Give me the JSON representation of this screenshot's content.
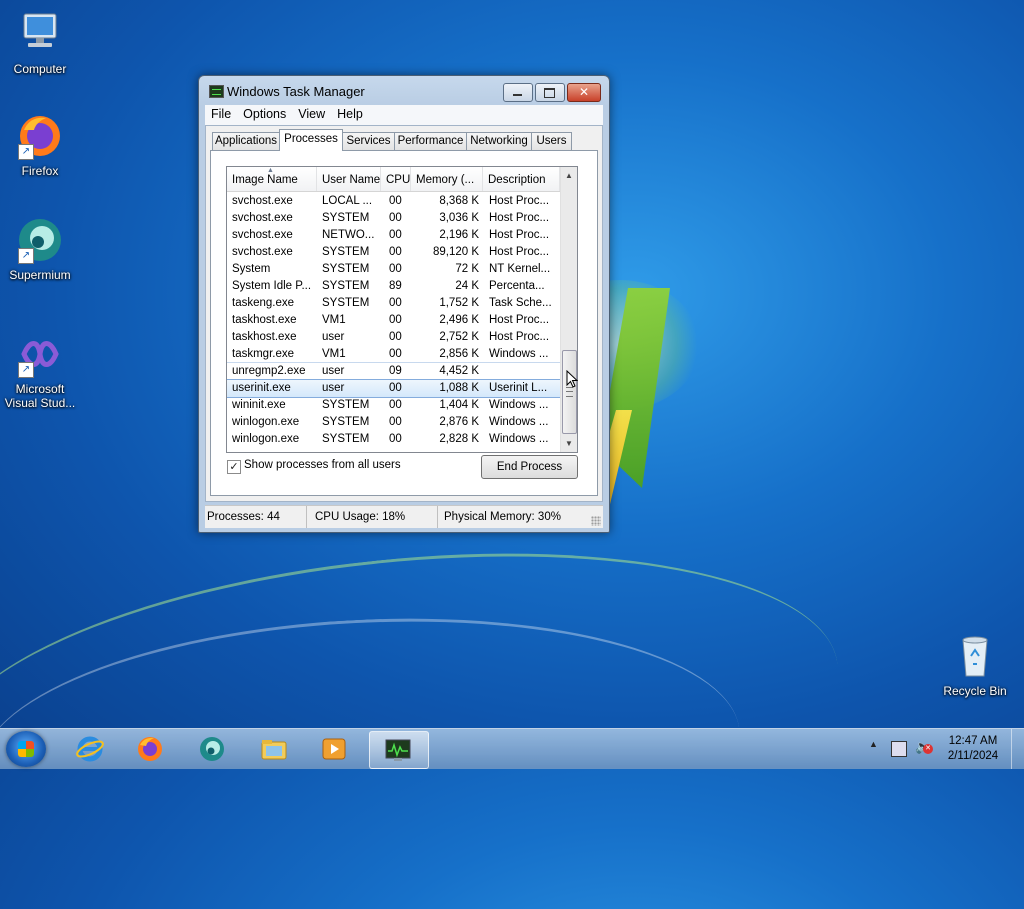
{
  "desktop": {
    "icons": [
      {
        "label": "Computer"
      },
      {
        "label": "Firefox"
      },
      {
        "label": "Supermium"
      },
      {
        "label": "Microsoft Visual Stud..."
      },
      {
        "label": "Recycle Bin"
      }
    ]
  },
  "window": {
    "title": "Windows Task Manager",
    "menu": [
      "File",
      "Options",
      "View",
      "Help"
    ],
    "tabs": [
      "Applications",
      "Processes",
      "Services",
      "Performance",
      "Networking",
      "Users"
    ],
    "active_tab": "Processes",
    "columns": [
      "Image Name",
      "User Name",
      "CPU",
      "Memory (...",
      "Description"
    ],
    "rows": [
      {
        "name": "svchost.exe",
        "user": "LOCAL ...",
        "cpu": "00",
        "mem": "8,368 K",
        "desc": "Host Proc..."
      },
      {
        "name": "svchost.exe",
        "user": "SYSTEM",
        "cpu": "00",
        "mem": "3,036 K",
        "desc": "Host Proc..."
      },
      {
        "name": "svchost.exe",
        "user": "NETWO...",
        "cpu": "00",
        "mem": "2,196 K",
        "desc": "Host Proc..."
      },
      {
        "name": "svchost.exe",
        "user": "SYSTEM",
        "cpu": "00",
        "mem": "89,120 K",
        "desc": "Host Proc..."
      },
      {
        "name": "System",
        "user": "SYSTEM",
        "cpu": "00",
        "mem": "72 K",
        "desc": "NT Kernel..."
      },
      {
        "name": "System Idle P...",
        "user": "SYSTEM",
        "cpu": "89",
        "mem": "24 K",
        "desc": "Percenta..."
      },
      {
        "name": "taskeng.exe",
        "user": "SYSTEM",
        "cpu": "00",
        "mem": "1,752 K",
        "desc": "Task Sche..."
      },
      {
        "name": "taskhost.exe",
        "user": "VM1",
        "cpu": "00",
        "mem": "2,496 K",
        "desc": "Host Proc..."
      },
      {
        "name": "taskhost.exe",
        "user": "user",
        "cpu": "00",
        "mem": "2,752 K",
        "desc": "Host Proc..."
      },
      {
        "name": "taskmgr.exe",
        "user": "VM1",
        "cpu": "00",
        "mem": "2,856 K",
        "desc": "Windows ..."
      },
      {
        "name": "unregmp2.exe",
        "user": "user",
        "cpu": "09",
        "mem": "4,452 K",
        "desc": ""
      },
      {
        "name": "userinit.exe",
        "user": "user",
        "cpu": "00",
        "mem": "1,088 K",
        "desc": "Userinit L..."
      },
      {
        "name": "wininit.exe",
        "user": "SYSTEM",
        "cpu": "00",
        "mem": "1,404 K",
        "desc": "Windows ..."
      },
      {
        "name": "winlogon.exe",
        "user": "SYSTEM",
        "cpu": "00",
        "mem": "2,876 K",
        "desc": "Windows ..."
      },
      {
        "name": "winlogon.exe",
        "user": "SYSTEM",
        "cpu": "00",
        "mem": "2,828 K",
        "desc": "Windows ..."
      }
    ],
    "selected_row_index": 11,
    "hovered_row_index": 10,
    "show_all_label": "Show processes from all users",
    "show_all_checked": true,
    "end_process_label": "End Process",
    "status": {
      "processes": "Processes: 44",
      "cpu": "CPU Usage: 18%",
      "memory": "Physical Memory: 30%"
    }
  },
  "taskbar": {
    "apps": [
      "internet-explorer-icon",
      "firefox-icon",
      "supermium-icon",
      "file-explorer-icon",
      "media-player-icon",
      "task-manager-icon"
    ],
    "active_app": "task-manager-icon",
    "clock_time": "12:47 AM",
    "clock_date": "2/11/2024"
  },
  "colors": {
    "selection": "#d4e8fb",
    "desktop": "#1670c9",
    "taskbar": "#8fb1d6"
  }
}
